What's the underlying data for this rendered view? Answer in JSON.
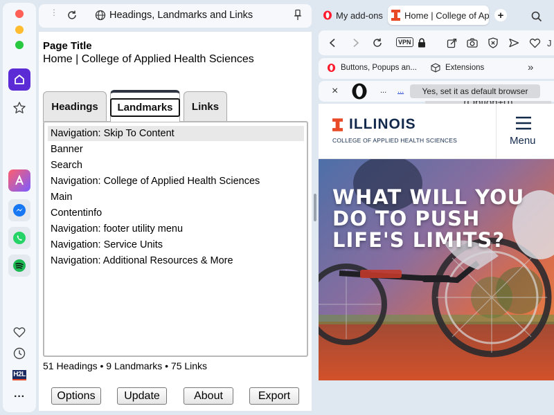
{
  "sidebar": {
    "items": [
      {
        "name": "home-icon"
      },
      {
        "name": "star-icon"
      },
      {
        "name": "aria-icon"
      },
      {
        "name": "messenger-icon"
      },
      {
        "name": "whatsapp-icon"
      },
      {
        "name": "spotify-icon"
      },
      {
        "name": "heart-icon"
      },
      {
        "name": "history-icon"
      },
      {
        "name": "h2l-icon",
        "label": "H2L"
      },
      {
        "name": "more-icon",
        "label": "···"
      }
    ]
  },
  "extension": {
    "title": "Headings, Landmarks and Links",
    "page_title_label": "Page Title",
    "page_title_value": "Home | College of Applied Health Sciences",
    "tabs": [
      {
        "label": "Headings"
      },
      {
        "label": "Landmarks"
      },
      {
        "label": "Links"
      }
    ],
    "active_tab": "Landmarks",
    "landmarks": [
      "Navigation: Skip To Content",
      "Banner",
      "Search",
      "Navigation: College of Applied Health Sciences",
      "Main",
      "Contentinfo",
      "Navigation: footer utility menu",
      "Navigation: Service Units",
      "Navigation: Additional Resources & More"
    ],
    "summary": "51 Headings • 9 Landmarks • 75 Links",
    "buttons": {
      "options": "Options",
      "update": "Update",
      "about": "About",
      "export": "Export"
    }
  },
  "browser": {
    "tabs": [
      {
        "label": "My add-ons",
        "icon": "opera-icon"
      },
      {
        "label": "Home | College of Ap",
        "icon": "illinois-icon",
        "active": true
      }
    ],
    "vpn_label": "VPN",
    "bookmarks": [
      {
        "label": "Buttons, Popups an..."
      },
      {
        "label": "Extensions"
      }
    ],
    "bookmarks_more": "»",
    "infobar": {
      "close": "×",
      "dots": "...",
      "link": "...",
      "cta": "Yes, set it as default browser"
    },
    "tooltip": "(Option+0)"
  },
  "webpage": {
    "brand": "ILLINOIS",
    "subtitle": "COLLEGE OF APPLIED HEALTH SCIENCES",
    "menu_label": "Menu",
    "hero_lines": [
      "WHAT WILL YOU",
      "DO TO PUSH",
      "LIFE'S LIMITS?"
    ]
  },
  "colors": {
    "illinois_orange": "#e84a27",
    "illinois_blue": "#13294b",
    "opera_red": "#ff1b2d",
    "home_purple": "#5b2bd6"
  }
}
